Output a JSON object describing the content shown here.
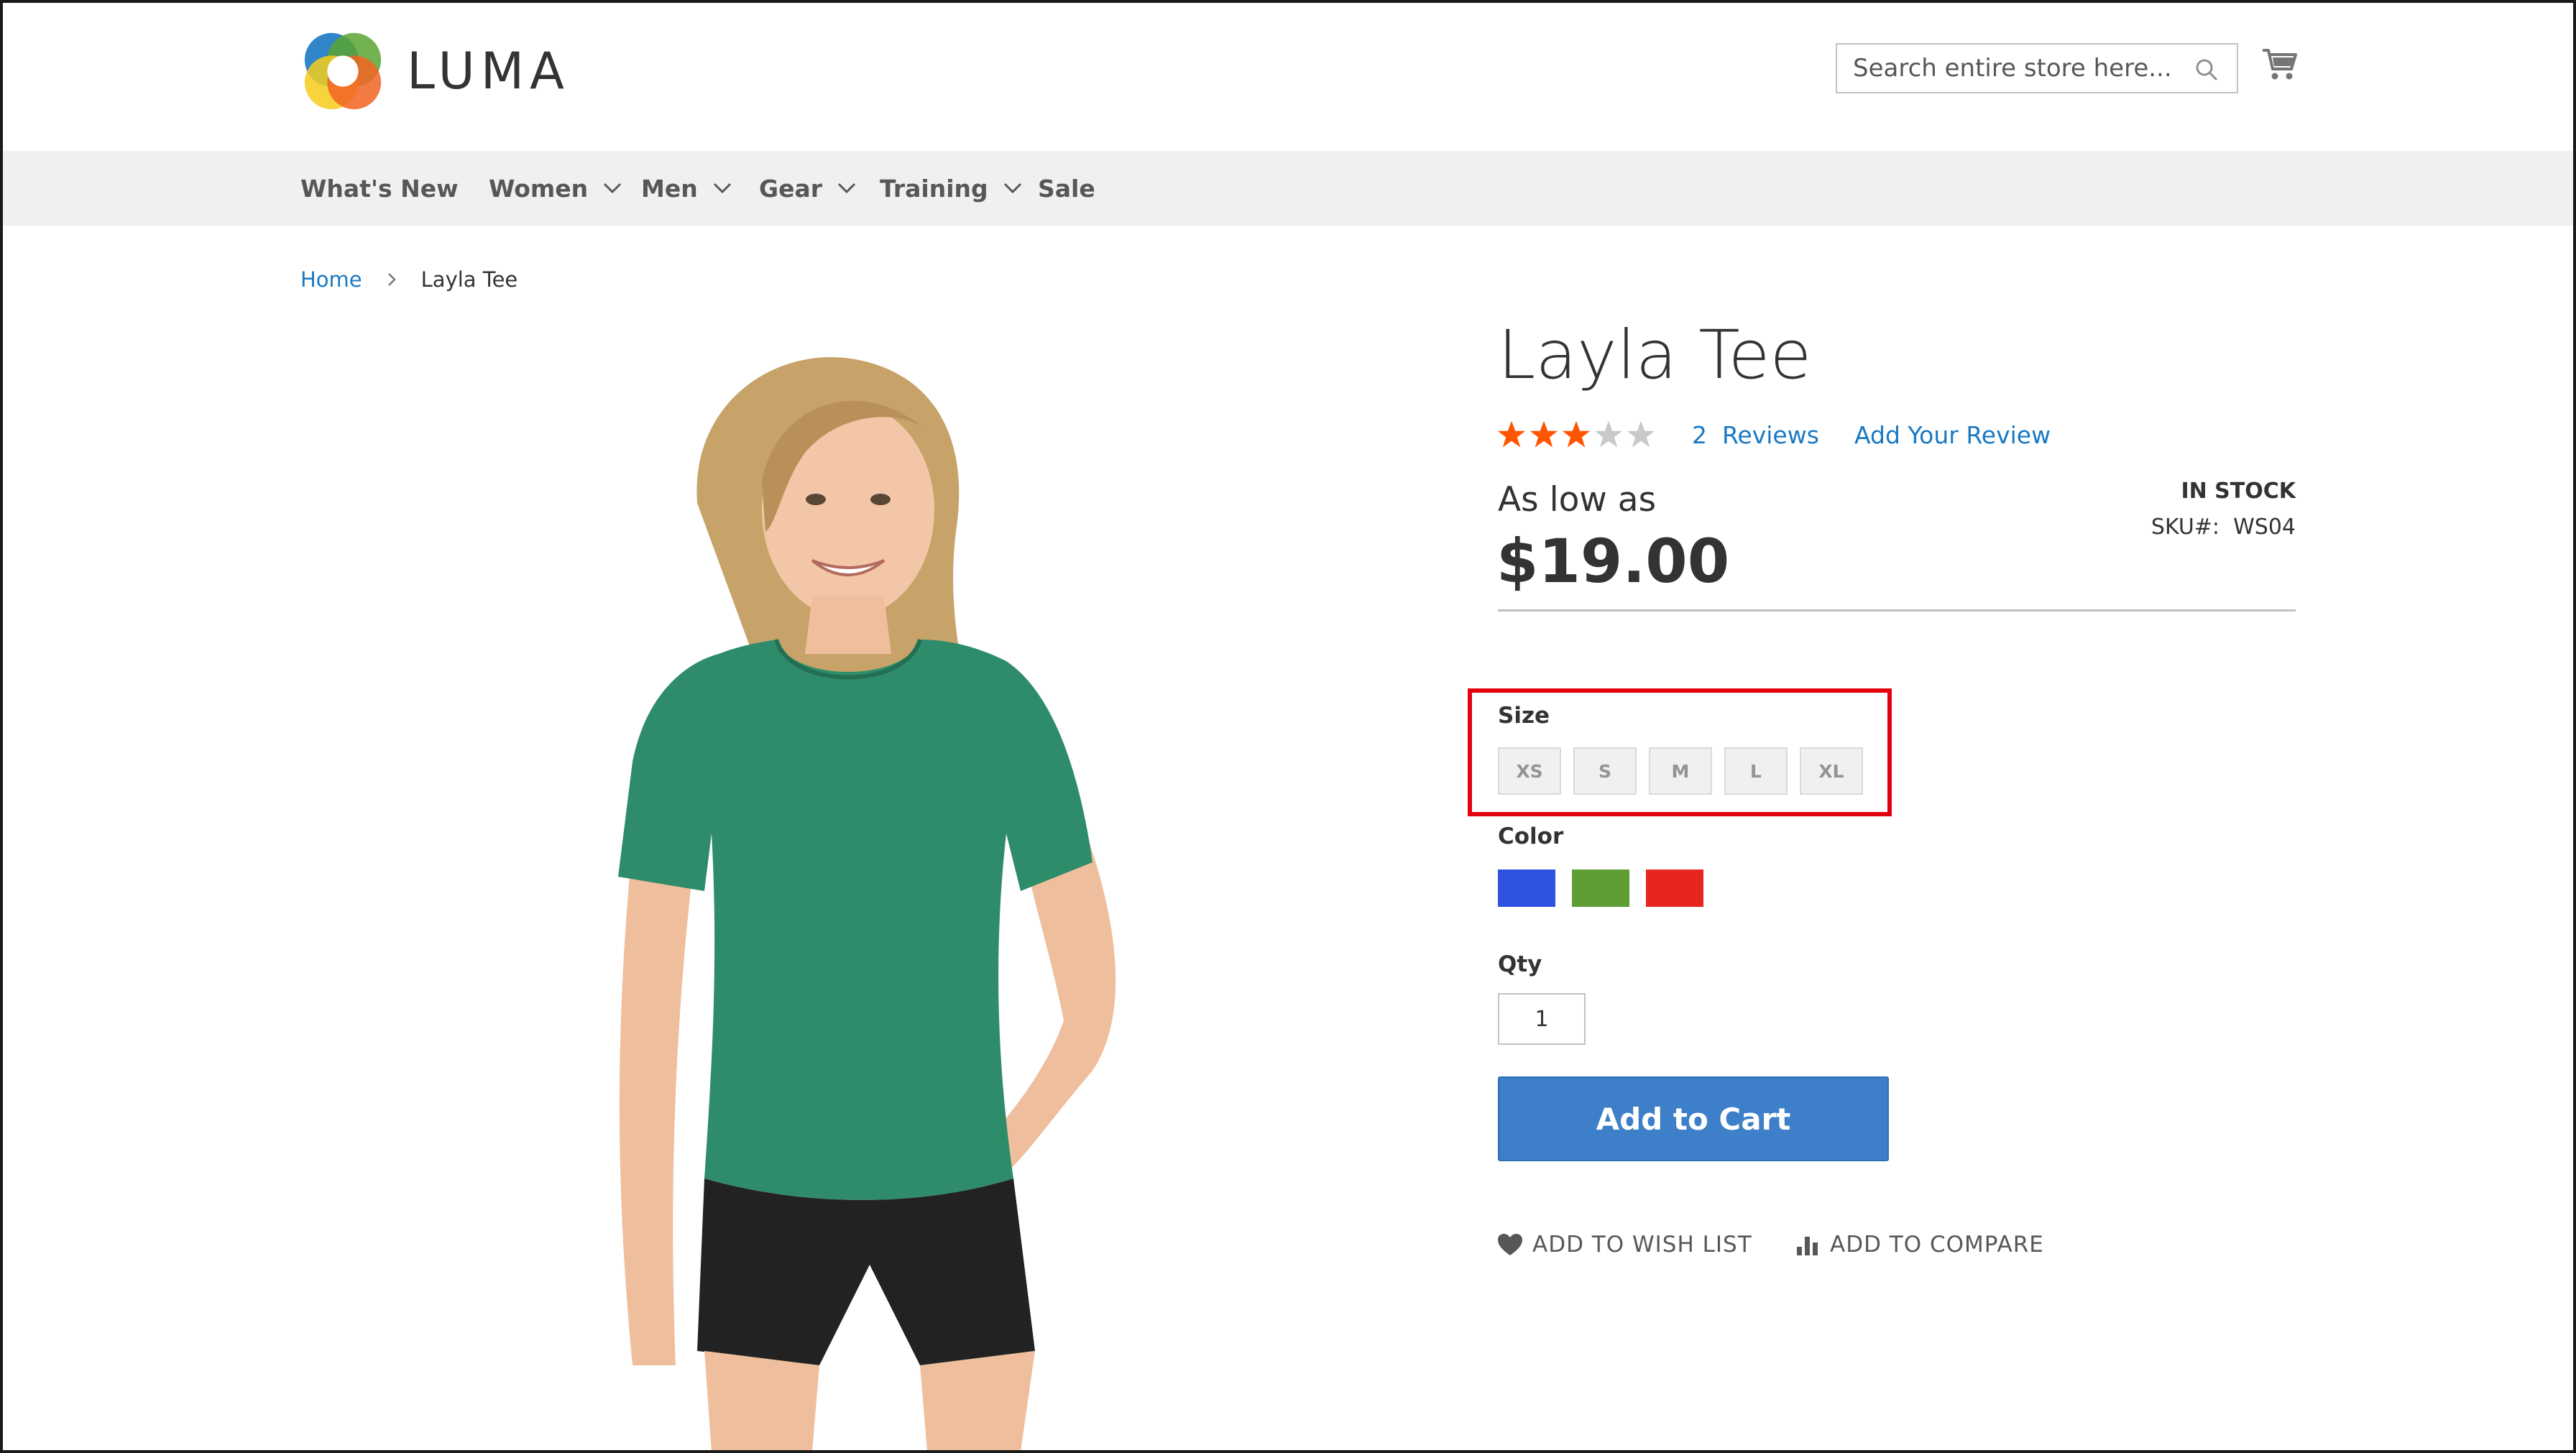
{
  "header": {
    "logo_text": "LUMA",
    "search_placeholder": "Search entire store here...",
    "icons": [
      "logo-icon",
      "search-icon",
      "cart-icon"
    ]
  },
  "nav": {
    "items": [
      {
        "label": "What's New",
        "dropdown": false
      },
      {
        "label": "Women",
        "dropdown": true
      },
      {
        "label": "Men",
        "dropdown": true
      },
      {
        "label": "Gear",
        "dropdown": true
      },
      {
        "label": "Training",
        "dropdown": true
      },
      {
        "label": "Sale",
        "dropdown": false
      }
    ]
  },
  "breadcrumb": {
    "home": "Home",
    "current": "Layla Tee"
  },
  "product": {
    "name": "Layla Tee",
    "rating": 3,
    "rating_max": 5,
    "reviews_count": "2",
    "reviews_label": "Reviews",
    "add_review": "Add Your Review",
    "price_prefix": "As low as",
    "price": "$19.00",
    "stock": "IN STOCK",
    "sku_label": "SKU#:",
    "sku_value": "WS04",
    "size_label": "Size",
    "sizes": [
      "XS",
      "S",
      "M",
      "L",
      "XL"
    ],
    "color_label": "Color",
    "colors": [
      "#2f52e0",
      "#5e9e35",
      "#e8261f"
    ],
    "qty_label": "Qty",
    "qty_value": "1",
    "add_to_cart": "Add to Cart",
    "wish_list": "ADD TO WISH LIST",
    "compare": "ADD TO COMPARE"
  },
  "colors": {
    "link": "#1979c3",
    "button": "#3d7fc8",
    "star": "#ff5501",
    "highlight": "#e3000f",
    "nav_bg": "#f0f0f0"
  }
}
